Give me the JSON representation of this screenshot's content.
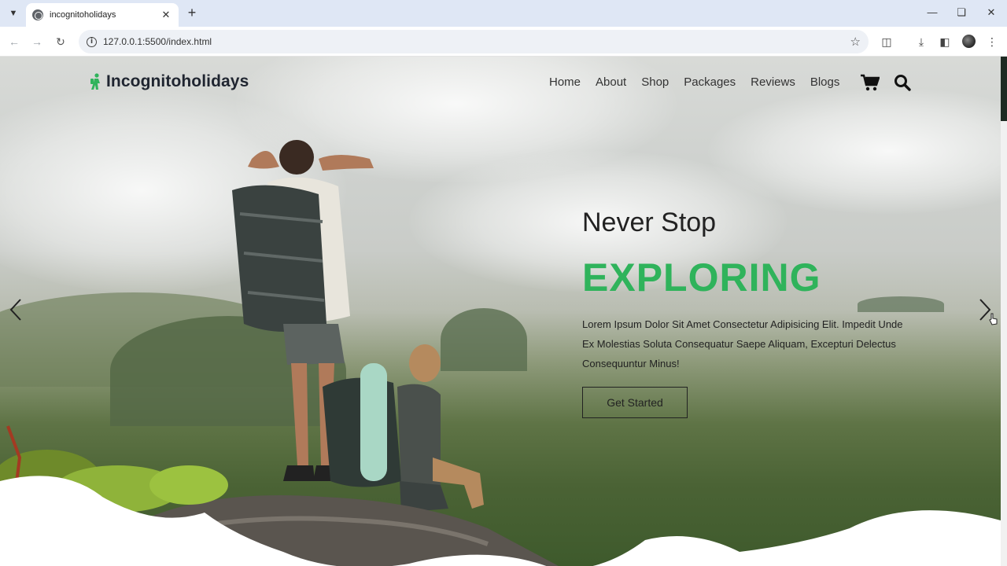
{
  "browser": {
    "tab_title": "incognitoholidays",
    "url": "127.0.0.1:5500/index.html"
  },
  "site": {
    "brand": "Incognitoholidays",
    "brand_color": "#2fb35b",
    "nav": [
      "Home",
      "About",
      "Shop",
      "Packages",
      "Reviews",
      "Blogs"
    ]
  },
  "hero": {
    "kicker": "Never Stop",
    "title": "EXPLORING",
    "title_color": "#2fb35b",
    "description": "Lorem Ipsum Dolor Sit Amet Consectetur Adipisicing Elit. Impedit Unde Ex Molestias Soluta Consequatur Saepe Aliquam, Excepturi Delectus Consequuntur Minus!",
    "button": "Get Started"
  },
  "icons": {
    "cart": "cart-icon",
    "search": "search-icon",
    "prev": "chevron-left-icon",
    "next": "chevron-right-icon"
  }
}
